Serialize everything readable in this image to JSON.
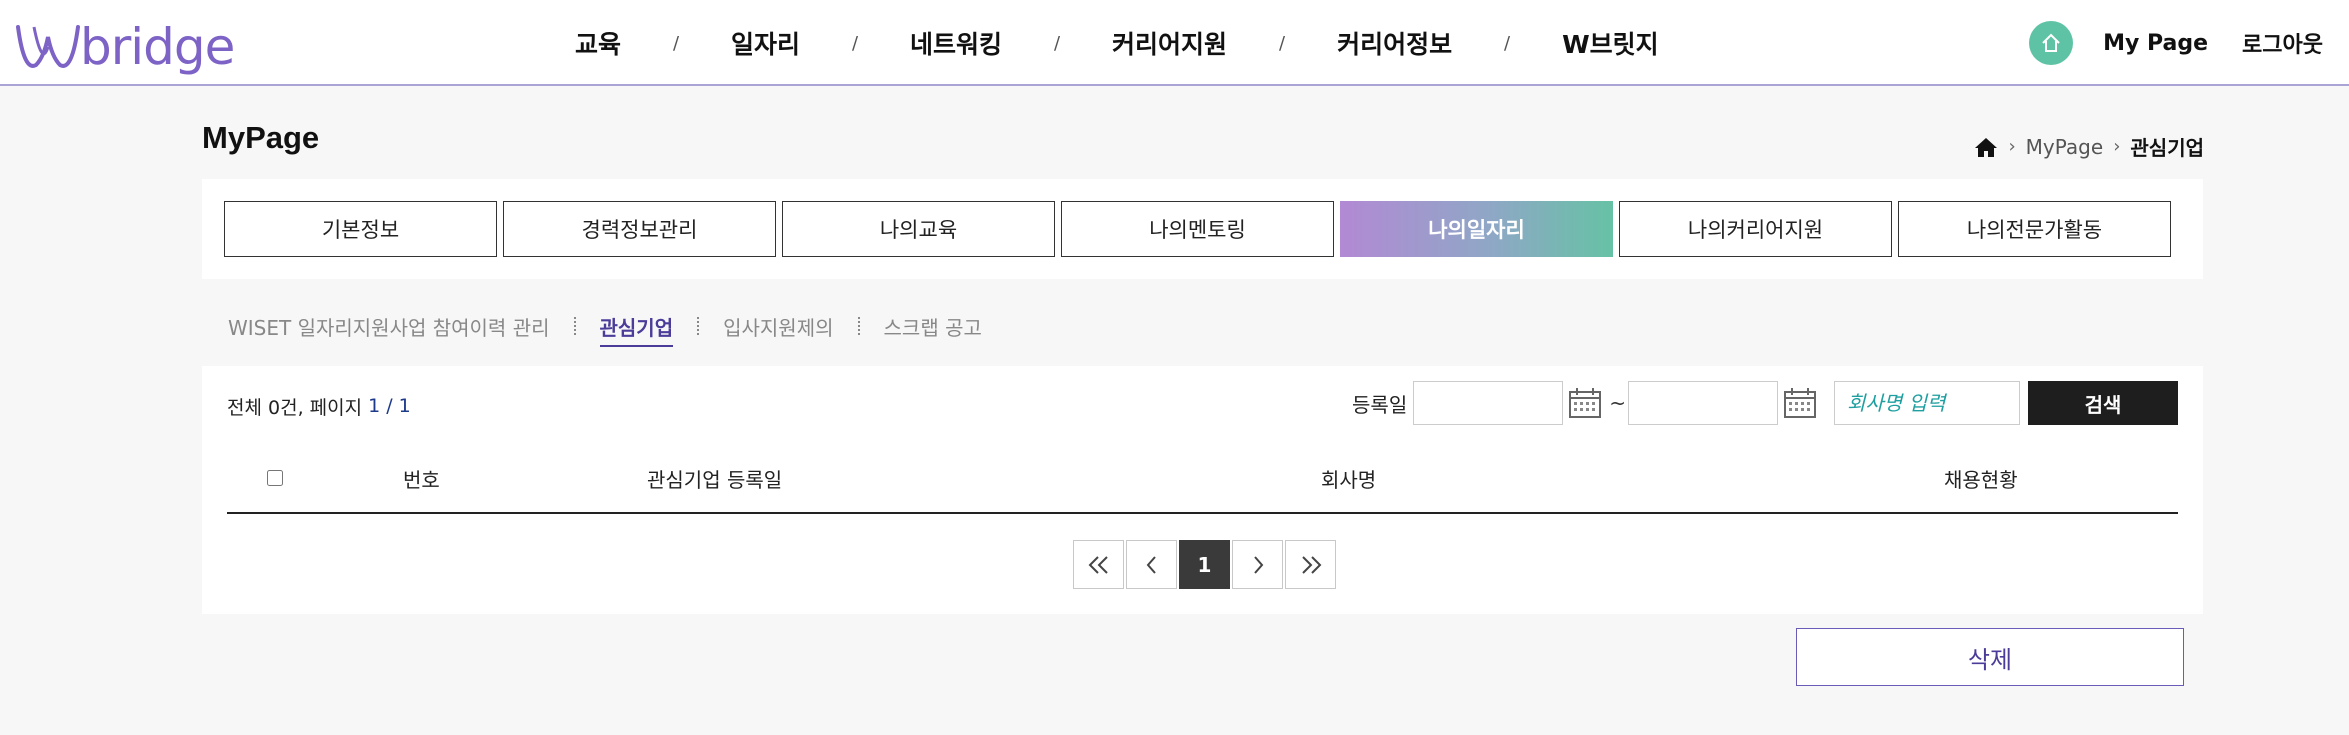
{
  "header": {
    "logo_text": "bridge",
    "nav": [
      "교육",
      "일자리",
      "네트워킹",
      "커리어지원",
      "커리어정보",
      "W브릿지"
    ],
    "nav_separator": "/",
    "mypage_label": "My Page",
    "logout_label": "로그아웃"
  },
  "page": {
    "title": "MyPage",
    "breadcrumb": [
      "MyPage",
      "관심기업"
    ]
  },
  "tabs": [
    {
      "label": "기본정보",
      "active": false
    },
    {
      "label": "경력정보관리",
      "active": false
    },
    {
      "label": "나의교육",
      "active": false
    },
    {
      "label": "나의멘토링",
      "active": false
    },
    {
      "label": "나의일자리",
      "active": true
    },
    {
      "label": "나의커리어지원",
      "active": false
    },
    {
      "label": "나의전문가활동",
      "active": false
    }
  ],
  "subtabs": [
    {
      "label": "WISET 일자리지원사업 참여이력 관리",
      "active": false
    },
    {
      "label": "관심기업",
      "active": true
    },
    {
      "label": "입사지원제의",
      "active": false
    },
    {
      "label": "스크랩 공고",
      "active": false
    }
  ],
  "list": {
    "total_text": "전체 0건, 페이지",
    "page_text": "1 / 1",
    "search_label": "등록일",
    "tilde": "~",
    "company_placeholder": "회사명 입력",
    "search_button": "검색",
    "columns": [
      "번호",
      "관심기업 등록일",
      "회사명",
      "채용현황"
    ],
    "current_page": "1"
  },
  "delete_button": "삭제",
  "colors": {
    "brand_purple": "#7d63c6",
    "active_tab_gradient": [
      "#b289d4",
      "#66c2a5"
    ],
    "home_circle": "#5ec3a4"
  }
}
